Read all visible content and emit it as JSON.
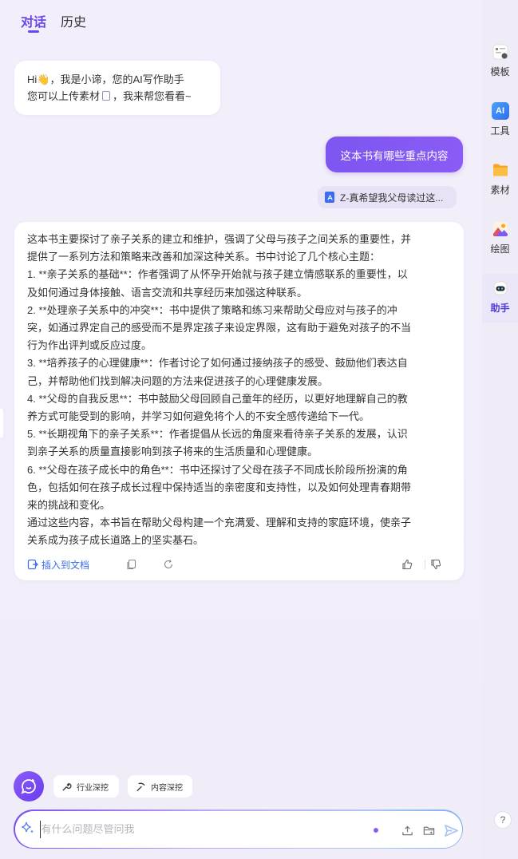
{
  "tabs": [
    {
      "label": "对话",
      "active": true
    },
    {
      "label": "历史",
      "active": false
    }
  ],
  "greeting": {
    "line1_prefix": "Hi",
    "wave_emoji": "👋",
    "line1_suffix": "，我是小谛，您的AI写作助手",
    "line2_prefix": "您可以上传素材",
    "line2_suffix": "，我来帮您看看~"
  },
  "user_message": "这本书有哪些重点内容",
  "attachment": {
    "name": "Z-真希望我父母读过这...",
    "icon": "pdf-icon"
  },
  "answer": {
    "lines": [
      "这本书主要探讨了亲子关系的建立和维护，强调了父母与孩子之间关系的重要性，并",
      "提供了一系列方法和策略来改善和加深这种关系。书中讨论了几个核心主题：",
      "1. **亲子关系的基础**：作者强调了从怀孕开始就与孩子建立情感联系的重要性，以",
      "及如何通过身体接触、语言交流和共享经历来加强这种联系。",
      "2. **处理亲子关系中的冲突**：书中提供了策略和练习来帮助父母应对与孩子的冲",
      "突，如通过界定自己的感受而不是界定孩子来设定界限，这有助于避免对孩子的不当",
      "行为作出评判或反应过度。",
      "3. **培养孩子的心理健康**：作者讨论了如何通过接纳孩子的感受、鼓励他们表达自",
      "己，并帮助他们找到解决问题的方法来促进孩子的心理健康发展。",
      "4. **父母的自我反思**：书中鼓励父母回顾自己童年的经历，以更好地理解自己的教",
      "养方式可能受到的影响，并学习如何避免将个人的不安全感传递给下一代。",
      "5. **长期视角下的亲子关系**：作者提倡从长远的角度来看待亲子关系的发展，认识",
      "到亲子关系的质量直接影响到孩子将来的生活质量和心理健康。",
      "6. **父母在孩子成长中的角色**：书中还探讨了父母在孩子不同成长阶段所扮演的角",
      "色，包括如何在孩子成长过程中保持适当的亲密度和支持性，以及如何处理青春期带",
      "来的挑战和变化。",
      "通过这些内容，本书旨在帮助父母构建一个充满爱、理解和支持的家庭环境，使亲子",
      "关系成为孩子成长道路上的坚实基石。"
    ],
    "insert_label": "插入到文档"
  },
  "quick_actions": [
    {
      "label": "行业深挖",
      "icon": "wrench-icon"
    },
    {
      "label": "内容深挖",
      "icon": "pickaxe-icon"
    }
  ],
  "input": {
    "placeholder": "有什么问题尽管问我",
    "value": ""
  },
  "sidebar": {
    "items": [
      {
        "label": "模板",
        "icon": "template-icon",
        "active": false
      },
      {
        "label": "工具",
        "icon": "ai-tool-icon",
        "active": false,
        "icon_text": "AI"
      },
      {
        "label": "素材",
        "icon": "folder-icon",
        "active": false
      },
      {
        "label": "绘图",
        "icon": "image-icon",
        "active": false
      },
      {
        "label": "助手",
        "icon": "robot-icon",
        "active": true
      }
    ],
    "help_label": "?"
  },
  "colors": {
    "accent": "#6b47e8",
    "user_bubble": "#8159f2",
    "link_blue": "#3b6de8",
    "background": "#f2eefa"
  }
}
